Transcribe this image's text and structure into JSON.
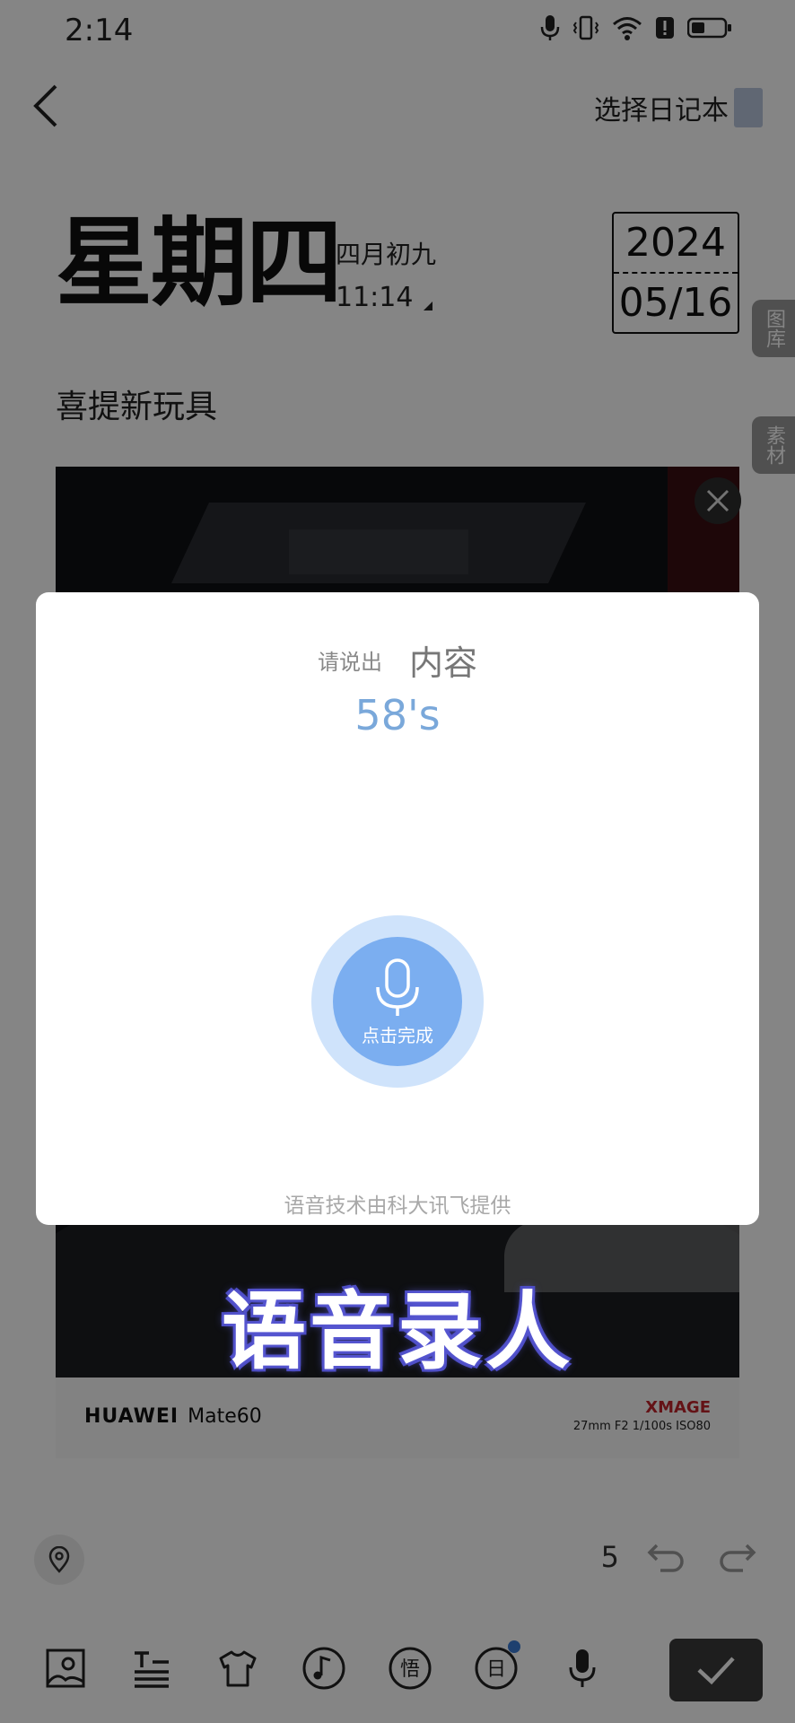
{
  "status_bar": {
    "time": "2:14"
  },
  "header": {
    "notebook_select": "选择日记本"
  },
  "date": {
    "weekday": "星期四",
    "lunar": "四月初九",
    "time": "11:14",
    "year": "2024",
    "month_day": "05/16"
  },
  "side_tabs": {
    "gallery": "图库",
    "materials": "素材"
  },
  "entry": {
    "title": "喜提新玩具"
  },
  "photo_watermark": {
    "brand": "HUAWEI",
    "model": "Mate60",
    "xmage": "XMAGE",
    "specs": "27mm  F2  1/100s  ISO80"
  },
  "footer": {
    "word_count": "5"
  },
  "voice_dialog": {
    "prompt_small": "请说出",
    "prompt_big": "内容",
    "timer": "58's",
    "mic_label": "点击完成",
    "credit": "语音技术由科大讯飞提供"
  },
  "caption": "语音录人",
  "colors": {
    "accent_blue": "#7baef0",
    "timer_blue": "#7aa8da",
    "mic_halo": "#cfe3fb"
  },
  "toolbar_icons": [
    "image-icon",
    "text-format-icon",
    "shirt-icon",
    "music-icon",
    "wu-icon",
    "calendar-day-icon",
    "microphone-icon"
  ]
}
